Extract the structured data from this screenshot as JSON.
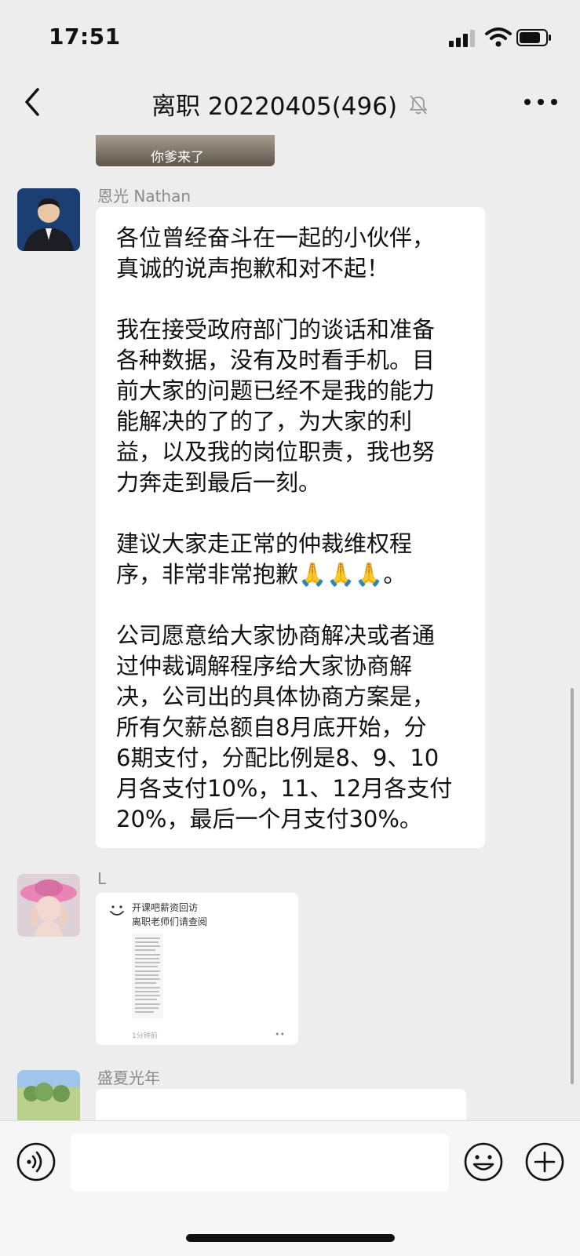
{
  "status_bar": {
    "time": "17:51"
  },
  "nav": {
    "title": "离职 20220405(496)"
  },
  "top_image": {
    "caption": "你爹来了"
  },
  "messages": [
    {
      "sender": "恩光 Nathan",
      "text": "各位曾经奋斗在一起的小伙伴，\n真诚的说声抱歉和对不起！\n\n我在接受政府部门的谈话和准备\n各种数据，没有及时看手机。目\n前大家的问题已经不是我的能力\n能解决的了的了，为大家的利\n益，以及我的岗位职责，我也努\n力奔走到最后一刻。\n\n建议大家走正常的仲裁维权程\n序，非常非常抱歉🙏🙏🙏。\n\n公司愿意给大家协商解决或者通\n过仲裁调解程序给大家协商解\n决，公司出的具体协商方案是，\n所有欠薪总额自8月底开始，分\n6期支付，分配比例是8、9、10\n月各支付10%，11、12月各支付\n20%，最后一个月支付30%。"
    },
    {
      "sender": "L",
      "file": {
        "title_line1": "开课吧薪资回访",
        "title_line2": "离职老师们请查阅",
        "time": "1分钟前"
      }
    },
    {
      "sender": "盛夏光年"
    }
  ],
  "colors": {
    "background": "#ededed",
    "bubble": "#ffffff",
    "sender_name": "#8a8a8a"
  },
  "icons": [
    "back-chevron-icon",
    "mute-bell-icon",
    "more-icon",
    "voice-icon",
    "emoji-icon",
    "plus-icon"
  ]
}
